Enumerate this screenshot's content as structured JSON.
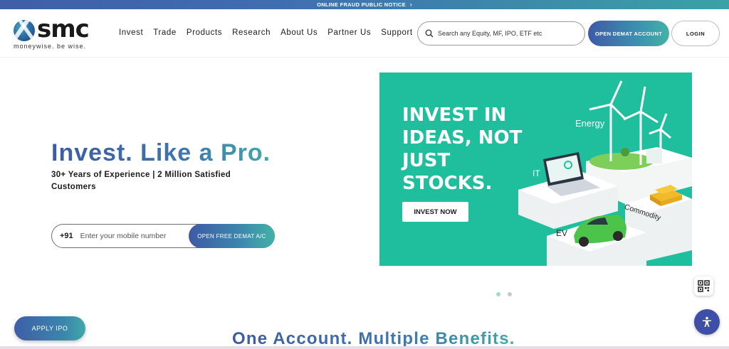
{
  "notice": {
    "text": "ONLINE FRAUD PUBLIC NOTICE",
    "icon": "chevron-right-icon"
  },
  "brand": {
    "name": "smc",
    "tagline": "moneywise. be wise.",
    "colors": {
      "primary": "#3d5ba3",
      "accent": "#42b2a6",
      "banner": "#1fbf9e"
    }
  },
  "nav": {
    "items": [
      {
        "label": "Invest"
      },
      {
        "label": "Trade"
      },
      {
        "label": "Products"
      },
      {
        "label": "Research"
      },
      {
        "label": "About Us"
      },
      {
        "label": "Partner Us"
      },
      {
        "label": "Support"
      }
    ]
  },
  "search": {
    "placeholder": "Search any Equity, MF, IPO, ETF etc",
    "value": ""
  },
  "header_buttons": {
    "open_demat": "OPEN DEMAT ACCOUNT",
    "login": "LOGIN"
  },
  "hero": {
    "title": "Invest. Like a Pro.",
    "subtitle": "30+ Years of Experience | 2 Million Satisfied Customers",
    "phone_code": "+91",
    "phone_placeholder": "Enter your mobile number",
    "cta": "OPEN FREE DEMAT A/C"
  },
  "banner": {
    "headline": "INVEST IN IDEAS, NOT JUST STOCKS.",
    "cta": "INVEST NOW",
    "labels": {
      "energy": "Energy",
      "it": "IT",
      "commodity": "Commodity",
      "ev": "EV"
    }
  },
  "carousel": {
    "slides": 2,
    "active": 1
  },
  "floating": {
    "apply_ipo": "APPLY IPO",
    "qr_icon": "qr-code-icon",
    "accessibility_icon": "accessibility-icon"
  },
  "section": {
    "title": "One Account. Multiple Benefits."
  }
}
